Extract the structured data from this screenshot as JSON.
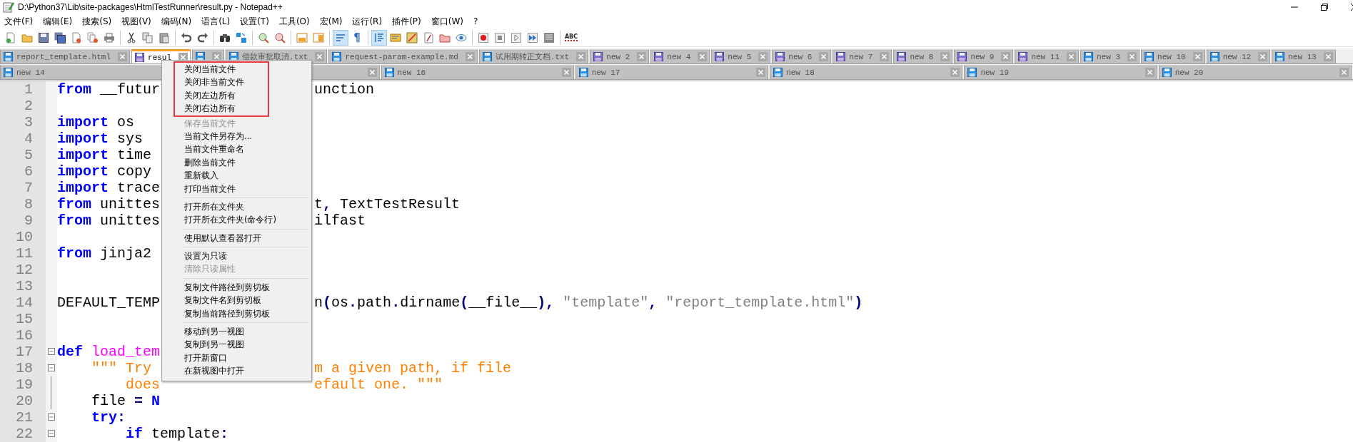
{
  "window": {
    "title": "D:\\Python37\\Lib\\site-packages\\HtmlTestRunner\\result.py - Notepad++"
  },
  "menubar": [
    "文件(F)",
    "编辑(E)",
    "搜索(S)",
    "视图(V)",
    "编码(N)",
    "语言(L)",
    "设置(T)",
    "工具(O)",
    "宏(M)",
    "运行(R)",
    "插件(P)",
    "窗口(W)",
    "?"
  ],
  "toolbar": [
    {
      "kind": "new",
      "pressed": false
    },
    {
      "kind": "open",
      "pressed": false
    },
    {
      "kind": "save",
      "pressed": false
    },
    {
      "kind": "save-all",
      "pressed": false
    },
    {
      "kind": "close",
      "pressed": false
    },
    {
      "kind": "close-all",
      "pressed": false
    },
    {
      "kind": "print",
      "pressed": false
    },
    {
      "kind": "separator"
    },
    {
      "kind": "cut",
      "pressed": false
    },
    {
      "kind": "copy",
      "pressed": false
    },
    {
      "kind": "paste",
      "pressed": false
    },
    {
      "kind": "separator"
    },
    {
      "kind": "undo",
      "pressed": false
    },
    {
      "kind": "redo",
      "pressed": false
    },
    {
      "kind": "separator"
    },
    {
      "kind": "find",
      "pressed": false
    },
    {
      "kind": "replace",
      "pressed": false
    },
    {
      "kind": "separator"
    },
    {
      "kind": "zoom-in",
      "pressed": false
    },
    {
      "kind": "zoom-out",
      "pressed": false
    },
    {
      "kind": "separator"
    },
    {
      "kind": "sync-v",
      "pressed": false
    },
    {
      "kind": "sync-h",
      "pressed": false
    },
    {
      "kind": "separator"
    },
    {
      "kind": "wrap",
      "pressed": true
    },
    {
      "kind": "glyph",
      "label": "¶",
      "pressed": false
    },
    {
      "kind": "separator"
    },
    {
      "kind": "indent",
      "pressed": true
    },
    {
      "kind": "lang",
      "pressed": false
    },
    {
      "kind": "map",
      "pressed": false
    },
    {
      "kind": "func",
      "pressed": false
    },
    {
      "kind": "folder",
      "pressed": false
    },
    {
      "kind": "eye",
      "pressed": false
    },
    {
      "kind": "separator"
    },
    {
      "kind": "record",
      "pressed": false
    },
    {
      "kind": "stop",
      "pressed": false
    },
    {
      "kind": "play",
      "pressed": false
    },
    {
      "kind": "play-many",
      "pressed": false
    },
    {
      "kind": "save-macro",
      "pressed": false
    },
    {
      "kind": "separator"
    },
    {
      "kind": "spell",
      "label": "ABC",
      "pressed": false
    }
  ],
  "tab_rows": [
    [
      {
        "label": "report_template.html",
        "selected": false,
        "unsaved": false
      },
      {
        "label": "resul",
        "selected": true,
        "unsaved": true
      },
      {
        "selected": false,
        "unsaved": false
      },
      {
        "label": "偿款审批取消.txt",
        "selected": false,
        "unsaved": false
      },
      {
        "label": "request-param-example.md",
        "selected": false,
        "unsaved": false
      },
      {
        "label": "试用期转正文档.txt",
        "selected": false,
        "unsaved": false
      },
      {
        "label": "new 2",
        "selected": false,
        "unsaved": true
      },
      {
        "label": "new 4",
        "selected": false,
        "unsaved": true
      },
      {
        "label": "new 5",
        "selected": false,
        "unsaved": true
      },
      {
        "label": "new 6",
        "selected": false,
        "unsaved": true
      },
      {
        "label": "new 7",
        "selected": false,
        "unsaved": true
      },
      {
        "label": "new 8",
        "selected": false,
        "unsaved": true
      },
      {
        "label": "new 9",
        "selected": false,
        "unsaved": true
      },
      {
        "label": "new 11",
        "selected": false,
        "unsaved": true
      },
      {
        "label": "new 3",
        "selected": false,
        "unsaved": false
      },
      {
        "label": "new 10",
        "selected": false,
        "unsaved": false
      },
      {
        "label": "new 12",
        "selected": false,
        "unsaved": false
      },
      {
        "label": "new 13",
        "selected": false,
        "unsaved": false
      }
    ],
    [
      {
        "label": "new 14",
        "selected": false,
        "unsaved": false
      },
      {
        "label": "new 16",
        "selected": false,
        "unsaved": false
      },
      {
        "label": "new 17",
        "selected": false,
        "unsaved": false
      },
      {
        "label": "new 18",
        "selected": false,
        "unsaved": false
      },
      {
        "label": "new 19",
        "selected": false,
        "unsaved": false
      },
      {
        "label": "new 20",
        "selected": false,
        "unsaved": false
      }
    ]
  ],
  "editor": {
    "lines": [
      {
        "number": "1",
        "left": [
          {
            "kind": "keyword",
            "text": "from"
          },
          {
            "kind": "plain",
            "text": " __futur"
          }
        ],
        "right": [
          {
            "kind": "plain",
            "text": "unction"
          }
        ]
      },
      {
        "number": "2"
      },
      {
        "number": "3",
        "left": [
          {
            "kind": "keyword",
            "text": "import"
          },
          {
            "kind": "plain",
            "text": " os"
          }
        ]
      },
      {
        "number": "4",
        "left": [
          {
            "kind": "keyword",
            "text": "import"
          },
          {
            "kind": "plain",
            "text": " sys"
          }
        ]
      },
      {
        "number": "5",
        "left": [
          {
            "kind": "keyword",
            "text": "import"
          },
          {
            "kind": "plain",
            "text": " time"
          }
        ]
      },
      {
        "number": "6",
        "left": [
          {
            "kind": "keyword",
            "text": "import"
          },
          {
            "kind": "plain",
            "text": " copy"
          }
        ]
      },
      {
        "number": "7",
        "left": [
          {
            "kind": "keyword",
            "text": "import"
          },
          {
            "kind": "plain",
            "text": " trace"
          }
        ]
      },
      {
        "number": "8",
        "left": [
          {
            "kind": "keyword",
            "text": "from"
          },
          {
            "kind": "plain",
            "text": " unittes"
          }
        ],
        "right": [
          {
            "kind": "plain",
            "text": "t"
          },
          {
            "kind": "operator",
            "text": ","
          },
          {
            "kind": "plain",
            "text": " TextTestResult"
          }
        ]
      },
      {
        "number": "9",
        "left": [
          {
            "kind": "keyword",
            "text": "from"
          },
          {
            "kind": "plain",
            "text": " unittes"
          }
        ],
        "right": [
          {
            "kind": "plain",
            "text": "ilfast"
          }
        ]
      },
      {
        "number": "10"
      },
      {
        "number": "11",
        "left": [
          {
            "kind": "keyword",
            "text": "from"
          },
          {
            "kind": "plain",
            "text": " jinja2"
          }
        ]
      },
      {
        "number": "12"
      },
      {
        "number": "13"
      },
      {
        "number": "14",
        "left": [
          {
            "kind": "plain",
            "text": "DEFAULT_TEMP"
          }
        ],
        "right": [
          {
            "kind": "plain",
            "text": "n"
          },
          {
            "kind": "operator",
            "text": "("
          },
          {
            "kind": "plain",
            "text": "os"
          },
          {
            "kind": "operator",
            "text": "."
          },
          {
            "kind": "plain",
            "text": "path"
          },
          {
            "kind": "operator",
            "text": "."
          },
          {
            "kind": "plain",
            "text": "dirname"
          },
          {
            "kind": "operator",
            "text": "("
          },
          {
            "kind": "plain",
            "text": "__file__"
          },
          {
            "kind": "operator",
            "text": "),"
          },
          {
            "kind": "string",
            "text": " \"template\""
          },
          {
            "kind": "operator",
            "text": ","
          },
          {
            "kind": "string",
            "text": " \"report_template.html\""
          },
          {
            "kind": "operator",
            "text": ")"
          }
        ]
      },
      {
        "number": "15"
      },
      {
        "number": "16"
      },
      {
        "number": "17",
        "fold_expanded": true,
        "left": [
          {
            "kind": "keyword",
            "text": "def"
          },
          {
            "kind": "defname",
            "text": " load_tem"
          }
        ]
      },
      {
        "number": "18",
        "fold_expanded": true,
        "left": [
          {
            "kind": "docstring",
            "text": "    \"\"\" Try"
          }
        ],
        "right": [
          {
            "kind": "docstring",
            "text": "m a given path, if file"
          }
        ]
      },
      {
        "number": "19",
        "in_fold": true,
        "left": [
          {
            "kind": "docstring",
            "text": "        does"
          }
        ],
        "right": [
          {
            "kind": "docstring",
            "text": "efault one. \"\"\""
          }
        ]
      },
      {
        "number": "20",
        "in_fold": true,
        "left": [
          {
            "kind": "plain",
            "text": "    file "
          },
          {
            "kind": "operator",
            "text": "="
          },
          {
            "kind": "keyword",
            "text": " N"
          }
        ]
      },
      {
        "number": "21",
        "fold_expanded": true,
        "left": [
          {
            "kind": "keyword",
            "text": "    try"
          },
          {
            "kind": "operator",
            "text": ":"
          }
        ]
      },
      {
        "number": "22",
        "fold_expanded": true,
        "left": [
          {
            "kind": "keyword",
            "text": "        if"
          },
          {
            "kind": "plain",
            "text": " template"
          },
          {
            "kind": "operator",
            "text": ":"
          }
        ]
      }
    ]
  },
  "context_menu": {
    "sections": [
      [
        {
          "label": "关闭当前文件",
          "disabled": false,
          "highlighted": true
        },
        {
          "label": "关闭非当前文件",
          "disabled": false,
          "highlighted": true
        },
        {
          "label": "关闭左边所有",
          "disabled": false,
          "highlighted": true
        },
        {
          "label": "关闭右边所有",
          "disabled": false,
          "highlighted": true
        },
        {
          "label": "保存当前文件",
          "disabled": true,
          "highlighted": false
        },
        {
          "label": "当前文件另存为...",
          "disabled": false,
          "highlighted": false
        },
        {
          "label": "当前文件重命名",
          "disabled": false,
          "highlighted": false
        },
        {
          "label": "删除当前文件",
          "disabled": false,
          "highlighted": false
        },
        {
          "label": "重新载入",
          "disabled": false,
          "highlighted": false
        },
        {
          "label": "打印当前文件",
          "disabled": false,
          "highlighted": false
        }
      ],
      [
        {
          "label": "打开所在文件夹",
          "disabled": false,
          "highlighted": false
        },
        {
          "label": "打开所在文件夹(命令行)",
          "disabled": false,
          "highlighted": false
        }
      ],
      [
        {
          "label": "使用默认查看器打开",
          "disabled": false,
          "highlighted": false
        }
      ],
      [
        {
          "label": "设置为只读",
          "disabled": false,
          "highlighted": false
        },
        {
          "label": "清除只读属性",
          "disabled": true,
          "highlighted": false
        }
      ],
      [
        {
          "label": "复制文件路径到剪切板",
          "disabled": false,
          "highlighted": false
        },
        {
          "label": "复制文件名到剪切板",
          "disabled": false,
          "highlighted": false
        },
        {
          "label": "复制当前路径到剪切板",
          "disabled": false,
          "highlighted": false
        }
      ],
      [
        {
          "label": "移动到另一视图",
          "disabled": false,
          "highlighted": false
        },
        {
          "label": "复制到另一视图",
          "disabled": false,
          "highlighted": false
        },
        {
          "label": "打开新窗口",
          "disabled": false,
          "highlighted": false
        },
        {
          "label": "在新视图中打开",
          "disabled": false,
          "highlighted": false
        }
      ]
    ]
  }
}
